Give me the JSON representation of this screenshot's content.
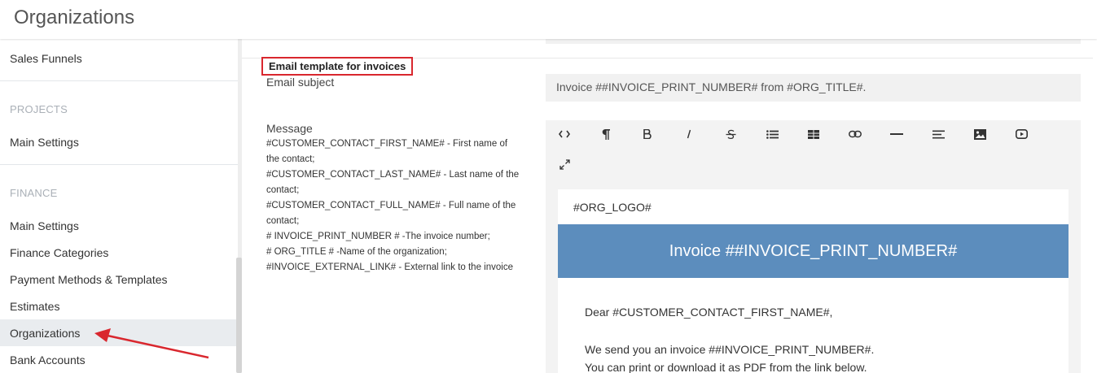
{
  "header": {
    "title": "Organizations"
  },
  "sidebar": {
    "items_top": [
      "Sales Funnels"
    ],
    "projects_label": "PROJECTS",
    "projects_items": [
      "Main Settings"
    ],
    "finance_label": "FINANCE",
    "finance_items": [
      "Main Settings",
      "Finance Categories",
      "Payment Methods & Templates",
      "Estimates",
      "Organizations",
      "Bank Accounts"
    ],
    "active_item": "Organizations"
  },
  "form": {
    "section_title": "Email template for invoices",
    "subject_label": "Email subject",
    "subject_value": "Invoice ##INVOICE_PRINT_NUMBER# from #ORG_TITLE#.",
    "message_label": "Message",
    "hint_lines": [
      "#CUSTOMER_CONTACT_FIRST_NAME# - First name of",
      "the contact;",
      "#CUSTOMER_CONTACT_LAST_NAME# - Last name of the",
      "contact;",
      "#CUSTOMER_CONTACT_FULL_NAME# - Full name of the",
      "contact;",
      "# INVOICE_PRINT_NUMBER # -The invoice number;",
      "# ORG_TITLE # -Name of the organization;",
      "#INVOICE_EXTERNAL_LINK# - External link to the invoice"
    ]
  },
  "editor": {
    "toolbar_icons": [
      "code-view-icon",
      "paragraph-icon",
      "bold-icon",
      "italic-icon",
      "strikethrough-icon",
      "bullet-list-icon",
      "table-icon",
      "link-icon",
      "horizontal-rule-icon",
      "align-icon",
      "image-icon",
      "video-icon",
      "fullscreen-icon"
    ],
    "content": {
      "logo_placeholder": "#ORG_LOGO#",
      "banner_title": "Invoice ##INVOICE_PRINT_NUMBER#",
      "greeting": "Dear #CUSTOMER_CONTACT_FIRST_NAME#,",
      "line1": "We send you an invoice ##INVOICE_PRINT_NUMBER#.",
      "line2": "You can print or download it as PDF from the link below."
    }
  },
  "colors": {
    "accent_red": "#d9272e",
    "banner_blue": "#5c8dbd",
    "sidebar_active": "#e9ecef"
  }
}
